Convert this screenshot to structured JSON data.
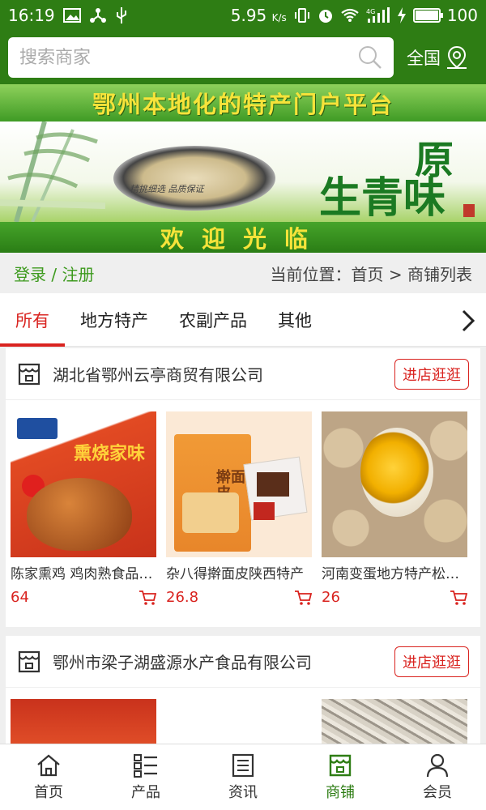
{
  "status": {
    "time": "16:19",
    "net_speed": "5.95",
    "speed_unit": "K/s",
    "battery": "100",
    "battery_level": 1.0
  },
  "search": {
    "placeholder": "搜索商家",
    "region": "全国"
  },
  "banner": {
    "headline": "鄂州本地化的特产门户平台",
    "welcome": "欢迎光临",
    "calligraphy_1": "原",
    "calligraphy_2": "生青味",
    "caption": "精挑细选 品质保证"
  },
  "locbar": {
    "login_register": "登录 / 注册",
    "location": "当前位置：首页 > 商铺列表"
  },
  "tabs": [
    {
      "label": "所有",
      "active": true
    },
    {
      "label": "地方特产",
      "active": false
    },
    {
      "label": "农副产品",
      "active": false
    },
    {
      "label": "其他",
      "active": false
    }
  ],
  "shops": [
    {
      "name": "湖北省鄂州云亭商贸有限公司",
      "enter_label": "进店逛逛",
      "products": [
        {
          "name": "陈家熏鸡 鸡肉熟食品 真空包装",
          "price": "64",
          "image_text": "熏烧家味"
        },
        {
          "name": "杂八得擀面皮陕西特产",
          "price": "26.8",
          "image_text": "擀面皮"
        },
        {
          "name": "河南变蛋地方特产松花蛋",
          "price": "26",
          "image_text": ""
        }
      ]
    },
    {
      "name": "鄂州市梁子湖盛源水产食品有限公司",
      "enter_label": "进店逛逛",
      "products": []
    }
  ],
  "bottom_nav": [
    {
      "label": "首页",
      "icon": "home-icon",
      "active": false
    },
    {
      "label": "产品",
      "icon": "list-icon",
      "active": false
    },
    {
      "label": "资讯",
      "icon": "news-icon",
      "active": false
    },
    {
      "label": "商铺",
      "icon": "store-icon",
      "active": true
    },
    {
      "label": "会员",
      "icon": "user-icon",
      "active": false
    }
  ],
  "colors": {
    "brand_green": "#2e7d14",
    "accent_red": "#d9231f"
  }
}
